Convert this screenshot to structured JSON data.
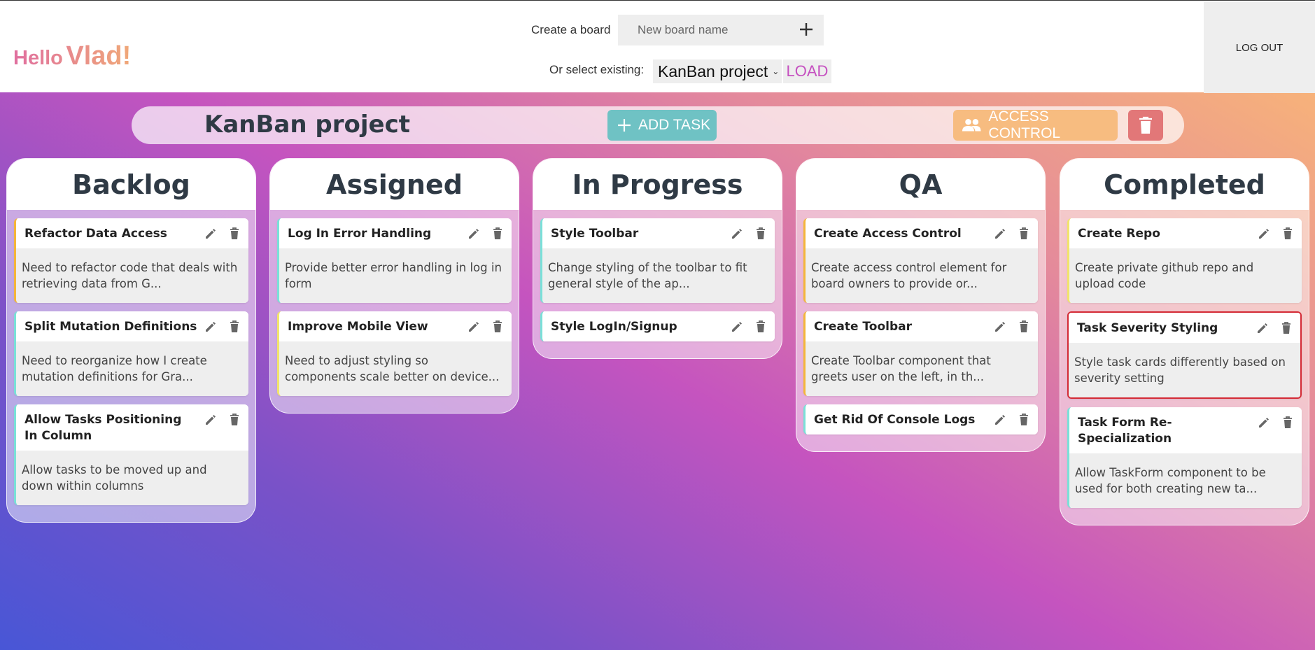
{
  "header": {
    "greeting_hello": "Hello",
    "greeting_name": "Vlad!",
    "create_label": "Create a board",
    "new_board_placeholder": "New board name",
    "select_label": "Or select existing:",
    "selected_board": "KanBan project",
    "load_label": "LOAD",
    "logout_label": "LOG OUT"
  },
  "toolbar": {
    "board_title": "KanBan project",
    "add_task_label": "ADD TASK",
    "access_control_label": "ACCESS CONTROL"
  },
  "colors": {
    "accent_teal": "#6fc2c4",
    "accent_orange": "#f7bc80",
    "danger": "#e27778",
    "load_text": "#c550c0"
  },
  "columns": [
    {
      "title": "Backlog",
      "tasks": [
        {
          "title": "Refactor Data Access",
          "description": "Need to refactor code that deals with retrieving data from G...",
          "severity": "warn"
        },
        {
          "title": "Split Mutation Definitions",
          "description": "Need to reorganize how I create mutation definitions for Gra...",
          "severity": "normal"
        },
        {
          "title": "Allow Tasks Positioning In Column",
          "description": "Allow tasks to be moved up and down within columns",
          "severity": "normal"
        }
      ]
    },
    {
      "title": "Assigned",
      "tasks": [
        {
          "title": "Log In Error Handling",
          "description": "Provide better error handling in log in form",
          "severity": "normal"
        },
        {
          "title": "Improve Mobile View",
          "description": "Need to adjust styling so components scale better on device...",
          "severity": "low"
        }
      ]
    },
    {
      "title": "In Progress",
      "tasks": [
        {
          "title": "Style Toolbar",
          "description": "Change styling of the toolbar to fit general style of the ap...",
          "severity": "normal"
        },
        {
          "title": "Style LogIn/Signup",
          "description": "",
          "severity": "normal"
        }
      ]
    },
    {
      "title": "QA",
      "tasks": [
        {
          "title": "Create Access Control",
          "description": "Create access control element for board owners to provide or...",
          "severity": "warn"
        },
        {
          "title": "Create Toolbar",
          "description": "Create Toolbar component that greets user on the left, in th...",
          "severity": "warn"
        },
        {
          "title": "Get Rid Of Console Logs",
          "description": "",
          "severity": "normal"
        }
      ]
    },
    {
      "title": "Completed",
      "tasks": [
        {
          "title": "Create Repo",
          "description": "Create private github repo and upload code",
          "severity": "low"
        },
        {
          "title": "Task Severity Styling",
          "description": "Style task cards differently based on severity setting",
          "severity": "high"
        },
        {
          "title": "Task Form Re-Specialization",
          "description": "Allow TaskForm component to be used for both creating new ta...",
          "severity": "normal"
        }
      ]
    }
  ]
}
